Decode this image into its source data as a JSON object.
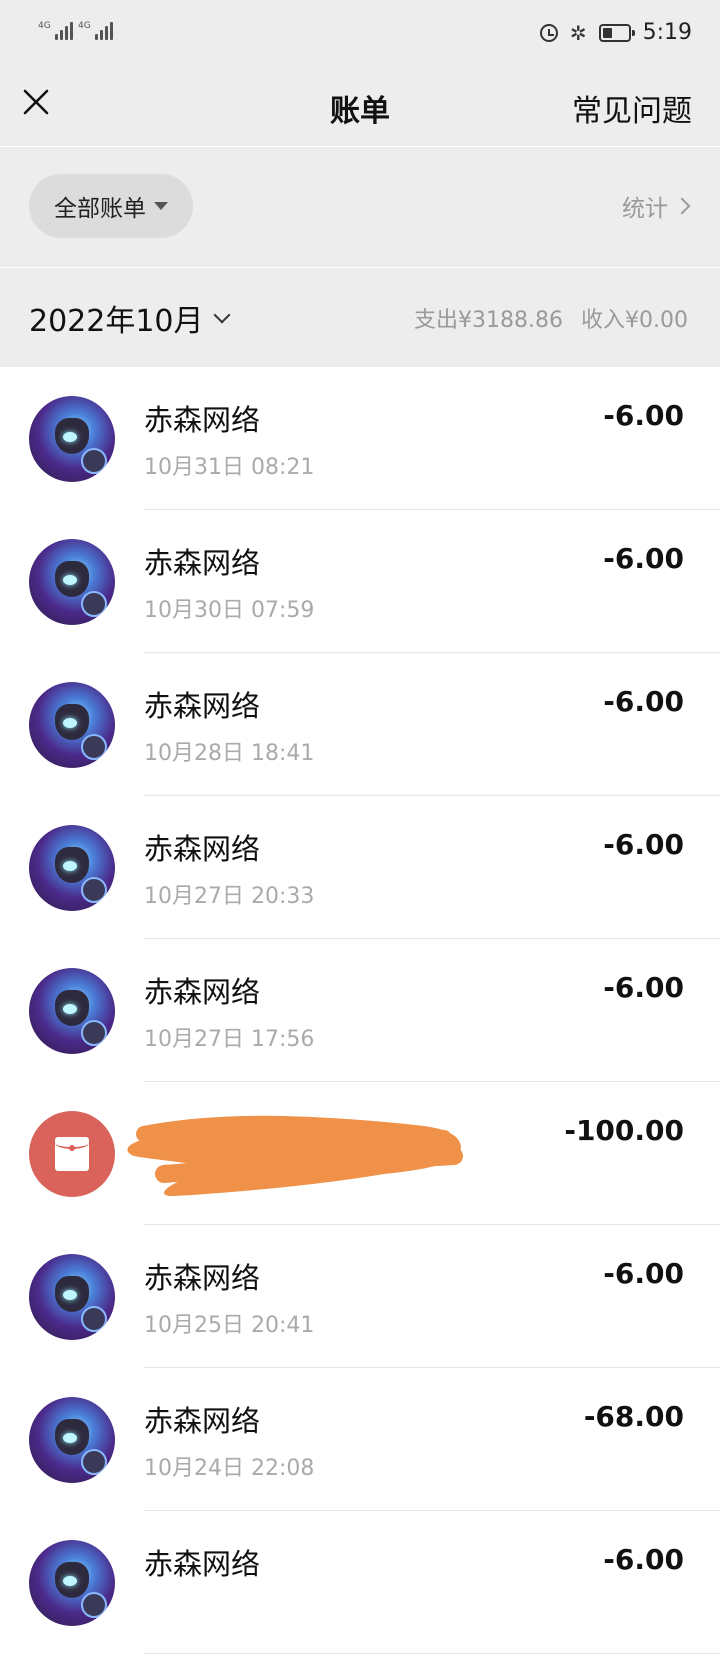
{
  "status_bar": {
    "signal_1": "4G",
    "signal_2": "4G",
    "time": "5:19",
    "icons": [
      "alarm-icon",
      "bluetooth-icon",
      "battery-icon"
    ]
  },
  "nav": {
    "title": "账单",
    "faq_label": "常见问题"
  },
  "filter": {
    "all_bills_label": "全部账单",
    "stats_label": "统计"
  },
  "month": {
    "label": "2022年10月",
    "expense": "支出¥3188.86",
    "income": "收入¥0.00"
  },
  "colors": {
    "header_bg": "#ededed",
    "redpacket": "#d9625a",
    "redaction": "#f0914a"
  },
  "transactions": [
    {
      "name": "赤森网络",
      "time": "10月31日 08:21",
      "amount": "-6.00",
      "avatar": "game-avatar"
    },
    {
      "name": "赤森网络",
      "time": "10月30日 07:59",
      "amount": "-6.00",
      "avatar": "game-avatar"
    },
    {
      "name": "赤森网络",
      "time": "10月28日 18:41",
      "amount": "-6.00",
      "avatar": "game-avatar"
    },
    {
      "name": "赤森网络",
      "time": "10月27日 20:33",
      "amount": "-6.00",
      "avatar": "game-avatar"
    },
    {
      "name": "赤森网络",
      "time": "10月27日 17:56",
      "amount": "-6.00",
      "avatar": "game-avatar"
    },
    {
      "name": "",
      "time": "",
      "amount": "-100.00",
      "avatar": "red-packet-icon",
      "redacted": true
    },
    {
      "name": "赤森网络",
      "time": "10月25日 20:41",
      "amount": "-6.00",
      "avatar": "game-avatar"
    },
    {
      "name": "赤森网络",
      "time": "10月24日 22:08",
      "amount": "-68.00",
      "avatar": "game-avatar"
    },
    {
      "name": "赤森网络",
      "time": "",
      "amount": "-6.00",
      "avatar": "game-avatar"
    }
  ]
}
